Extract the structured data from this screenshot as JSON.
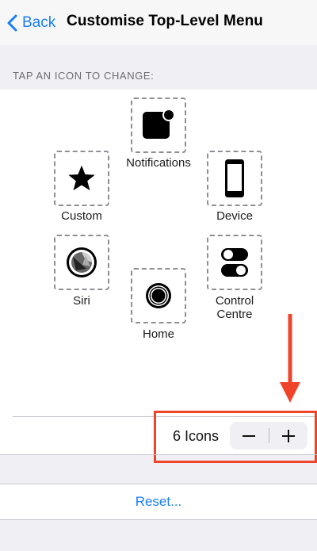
{
  "nav": {
    "back_label": "Back",
    "title": "Customise Top-Level Menu"
  },
  "section_header": "TAP AN ICON TO CHANGE:",
  "icons": [
    {
      "label": "Notifications",
      "icon": "notifications-icon"
    },
    {
      "label": "Custom",
      "icon": "star-icon"
    },
    {
      "label": "Device",
      "icon": "iphone-icon"
    },
    {
      "label": "Siri",
      "icon": "siri-icon"
    },
    {
      "label": "Control Centre",
      "line1": "Control",
      "line2": "Centre",
      "icon": "toggles-icon"
    },
    {
      "label": "Home",
      "icon": "home-button-icon"
    }
  ],
  "icon_count_label": "6 Icons",
  "stepper": {
    "minus": "minus",
    "plus": "plus"
  },
  "reset_label": "Reset...",
  "colors": {
    "accent": "#1a7ff5",
    "annotation": "#f0442a",
    "background": "#efeff4"
  }
}
